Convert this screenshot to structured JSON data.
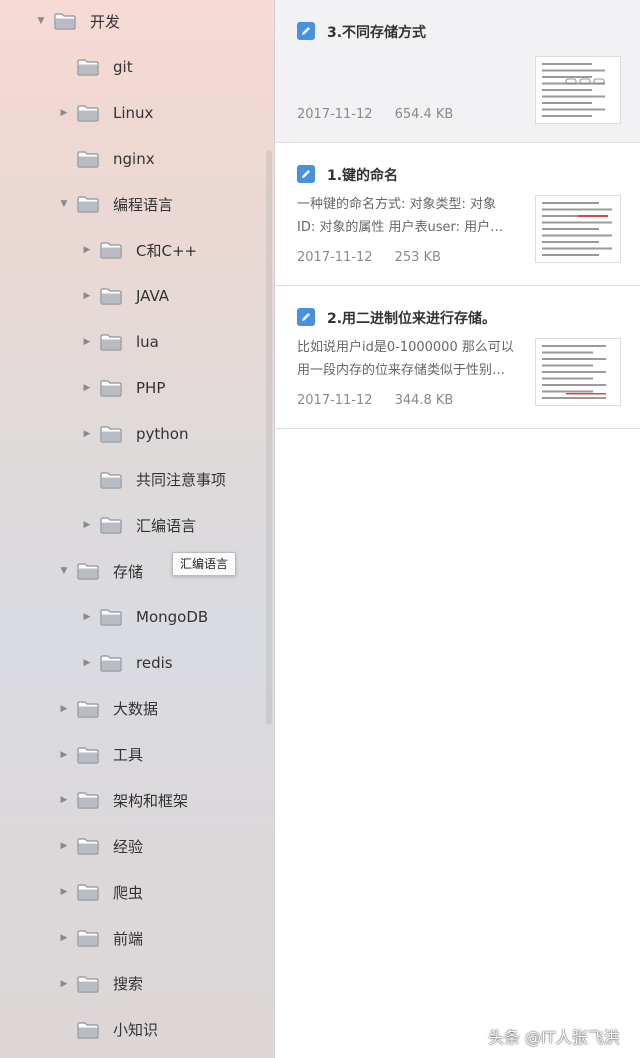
{
  "sidebar": {
    "items": [
      {
        "label": "开发",
        "level": 1,
        "arrow": "expanded"
      },
      {
        "label": "git",
        "level": 2,
        "arrow": "none"
      },
      {
        "label": "Linux",
        "level": 2,
        "arrow": "collapsed"
      },
      {
        "label": "nginx",
        "level": 2,
        "arrow": "none"
      },
      {
        "label": "编程语言",
        "level": 2,
        "arrow": "expanded"
      },
      {
        "label": "C和C++",
        "level": 3,
        "arrow": "collapsed"
      },
      {
        "label": "JAVA",
        "level": 3,
        "arrow": "collapsed"
      },
      {
        "label": "lua",
        "level": 3,
        "arrow": "collapsed"
      },
      {
        "label": "PHP",
        "level": 3,
        "arrow": "collapsed"
      },
      {
        "label": "python",
        "level": 3,
        "arrow": "collapsed"
      },
      {
        "label": "共同注意事项",
        "level": 3,
        "arrow": "none"
      },
      {
        "label": "汇编语言",
        "level": 3,
        "arrow": "collapsed"
      },
      {
        "label": "存储",
        "level": 2,
        "arrow": "expanded"
      },
      {
        "label": "MongoDB",
        "level": 3,
        "arrow": "collapsed"
      },
      {
        "label": "redis",
        "level": 3,
        "arrow": "collapsed"
      },
      {
        "label": "大数据",
        "level": 2,
        "arrow": "collapsed"
      },
      {
        "label": "工具",
        "level": 2,
        "arrow": "collapsed"
      },
      {
        "label": "架构和框架",
        "level": 2,
        "arrow": "collapsed"
      },
      {
        "label": "经验",
        "level": 2,
        "arrow": "collapsed"
      },
      {
        "label": "爬虫",
        "level": 2,
        "arrow": "collapsed"
      },
      {
        "label": "前端",
        "level": 2,
        "arrow": "collapsed"
      },
      {
        "label": "搜索",
        "level": 2,
        "arrow": "collapsed"
      },
      {
        "label": "小知识",
        "level": 2,
        "arrow": "none"
      }
    ],
    "tooltip": "汇编语言"
  },
  "notes": [
    {
      "title": "3.不同存储方式",
      "snippet": [],
      "date": "2017-11-12",
      "size": "654.4 KB",
      "selected": true
    },
    {
      "title": "1.键的命名",
      "snippet": [
        "一种键的命名方式:  对象类型: 对象",
        "ID:  对象的属性 用户表user:  用户…"
      ],
      "date": "2017-11-12",
      "size": "253 KB",
      "selected": false
    },
    {
      "title": "2.用二进制位来进行存储。",
      "snippet": [
        "比如说用户id是0-1000000 那么可以",
        "用一段内存的位来存储类似于性别…"
      ],
      "date": "2017-11-12",
      "size": "344.8 KB",
      "selected": false
    }
  ],
  "watermark": "头条 @IT人张飞洪",
  "colors": {
    "note_icon": "#4a8fe2",
    "folder": "#b9bcc2"
  }
}
